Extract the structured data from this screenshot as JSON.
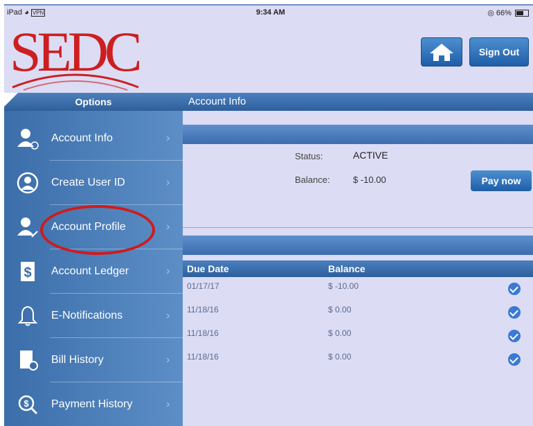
{
  "status_bar": {
    "device": "iPad",
    "vpn": "VPN",
    "time": "9:34 AM",
    "battery": "66%"
  },
  "header": {
    "logo_text": "SEDC",
    "signout_label": "Sign Out"
  },
  "sidebar": {
    "title": "Options",
    "items": [
      {
        "label": "Account Info",
        "icon": "user-info-icon"
      },
      {
        "label": "Create User ID",
        "icon": "user-circle-icon"
      },
      {
        "label": "Account Profile",
        "icon": "user-edit-icon"
      },
      {
        "label": "Account Ledger",
        "icon": "ledger-icon"
      },
      {
        "label": "E-Notifications",
        "icon": "bell-icon"
      },
      {
        "label": "Bill History",
        "icon": "bill-history-icon"
      },
      {
        "label": "Payment History",
        "icon": "payment-search-icon"
      }
    ]
  },
  "content": {
    "title": "Account Info",
    "status_label": "Status:",
    "status_value": "ACTIVE",
    "balance_label": "Balance:",
    "balance_value": "$ -10.00",
    "pay_label": "Pay now",
    "table": {
      "headers": [
        "Due Date",
        "Balance"
      ],
      "rows": [
        {
          "due": "01/17/17",
          "balance": "$ -10.00"
        },
        {
          "due": "11/18/16",
          "balance": "$ 0.00"
        },
        {
          "due": "11/18/16",
          "balance": "$ 0.00"
        },
        {
          "due": "11/18/16",
          "balance": "$ 0.00"
        }
      ]
    }
  },
  "colors": {
    "accent": "#2f5f99",
    "highlight": "#d11a1a",
    "logo": "#cc1f1f"
  }
}
